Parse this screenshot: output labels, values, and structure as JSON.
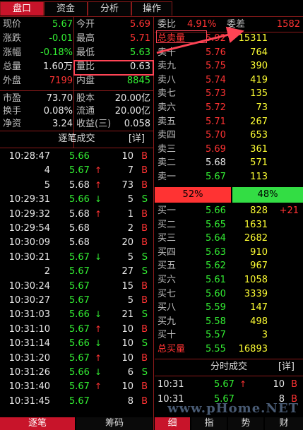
{
  "tabs": [
    "盘口",
    "资金",
    "分析",
    "操作"
  ],
  "quote": {
    "rows": [
      {
        "l1": "现价",
        "v1": "5.67",
        "c1": "g",
        "l2": "今开",
        "v2": "5.69",
        "c2": "r"
      },
      {
        "l1": "涨跌",
        "v1": "-0.01",
        "c1": "g",
        "l2": "最高",
        "v2": "5.71",
        "c2": "r"
      },
      {
        "l1": "涨幅",
        "v1": "-0.18%",
        "c1": "g",
        "l2": "最低",
        "v2": "5.63",
        "c2": "g"
      },
      {
        "l1": "总量",
        "v1": "1.60万",
        "c1": "w",
        "l2": "量比",
        "v2": "0.63",
        "c2": "w"
      },
      {
        "l1": "外盘",
        "v1": "7199",
        "c1": "r",
        "l2": "内盘",
        "v2": "8845",
        "c2": "g"
      },
      {
        "l1": "市盈",
        "v1": "73.70",
        "c1": "w",
        "l2": "股本",
        "v2": "20.00亿",
        "c2": "w"
      },
      {
        "l1": "换手",
        "v1": "0.08%",
        "c1": "w",
        "l2": "流通",
        "v2": "20.00亿",
        "c2": "w"
      },
      {
        "l1": "净资",
        "v1": "3.24",
        "c1": "w",
        "l2": "收益(三)",
        "v2": "0.058",
        "c2": "w"
      }
    ]
  },
  "ticks_header": {
    "title": "逐笔成交",
    "detail": "[详]"
  },
  "ticks": [
    {
      "t": "10:28:47",
      "p": "5.66",
      "pc": "g",
      "a": "",
      "ac": "",
      "v": "10",
      "d": "B",
      "dc": "r"
    },
    {
      "t": "4",
      "p": "5.67",
      "pc": "g",
      "a": "↑",
      "ac": "r",
      "v": "7",
      "d": "B",
      "dc": "r"
    },
    {
      "t": "5",
      "p": "5.68",
      "pc": "w",
      "a": "↑",
      "ac": "r",
      "v": "73",
      "d": "B",
      "dc": "r"
    },
    {
      "t": "10:29:31",
      "p": "5.66",
      "pc": "g",
      "a": "↓",
      "ac": "g",
      "v": "5",
      "d": "S",
      "dc": "g"
    },
    {
      "t": "10:29:32",
      "p": "5.68",
      "pc": "w",
      "a": "↑",
      "ac": "r",
      "v": "1",
      "d": "B",
      "dc": "r"
    },
    {
      "t": "10:29:54",
      "p": "5.68",
      "pc": "w",
      "a": "",
      "ac": "",
      "v": "2",
      "d": "B",
      "dc": "r"
    },
    {
      "t": "10:30:09",
      "p": "5.68",
      "pc": "w",
      "a": "",
      "ac": "",
      "v": "20",
      "d": "B",
      "dc": "r"
    },
    {
      "t": "10:30:21",
      "p": "5.67",
      "pc": "g",
      "a": "↓",
      "ac": "g",
      "v": "5",
      "d": "S",
      "dc": "g"
    },
    {
      "t": "2",
      "p": "5.67",
      "pc": "g",
      "a": "",
      "ac": "",
      "v": "27",
      "d": "S",
      "dc": "g"
    },
    {
      "t": "10:30:24",
      "p": "5.67",
      "pc": "g",
      "a": "",
      "ac": "",
      "v": "15",
      "d": "B",
      "dc": "r"
    },
    {
      "t": "10:30:27",
      "p": "5.67",
      "pc": "g",
      "a": "",
      "ac": "",
      "v": "5",
      "d": "B",
      "dc": "r"
    },
    {
      "t": "10:31:03",
      "p": "5.66",
      "pc": "g",
      "a": "↓",
      "ac": "g",
      "v": "21",
      "d": "S",
      "dc": "g"
    },
    {
      "t": "10:31:10",
      "p": "5.67",
      "pc": "g",
      "a": "↑",
      "ac": "r",
      "v": "10",
      "d": "B",
      "dc": "r"
    },
    {
      "t": "10:31:14",
      "p": "5.66",
      "pc": "g",
      "a": "↓",
      "ac": "g",
      "v": "10",
      "d": "S",
      "dc": "g"
    },
    {
      "t": "10:31:20",
      "p": "5.67",
      "pc": "g",
      "a": "↑",
      "ac": "r",
      "v": "10",
      "d": "B",
      "dc": "r"
    },
    {
      "t": "10:31:26",
      "p": "5.66",
      "pc": "g",
      "a": "↓",
      "ac": "g",
      "v": "6",
      "d": "S",
      "dc": "g"
    },
    {
      "t": "10:31:40",
      "p": "5.67",
      "pc": "g",
      "a": "↑",
      "ac": "r",
      "v": "10",
      "d": "B",
      "dc": "r"
    },
    {
      "t": "10:31:45",
      "p": "5.67",
      "pc": "g",
      "a": "",
      "ac": "",
      "v": "8",
      "d": "B",
      "dc": "r"
    }
  ],
  "left_tabs": [
    "逐笔",
    "筹码"
  ],
  "weibi": {
    "l1": "委比",
    "v1": "4.91%",
    "l2": "委差",
    "v2": "1582"
  },
  "sells": [
    {
      "l": "总卖量",
      "p": "5.92",
      "pc": "r",
      "v": "15311"
    },
    {
      "l": "卖十",
      "p": "5.76",
      "pc": "r",
      "v": "764"
    },
    {
      "l": "卖九",
      "p": "5.75",
      "pc": "r",
      "v": "390"
    },
    {
      "l": "卖八",
      "p": "5.74",
      "pc": "r",
      "v": "419"
    },
    {
      "l": "卖七",
      "p": "5.73",
      "pc": "r",
      "v": "135"
    },
    {
      "l": "卖六",
      "p": "5.72",
      "pc": "r",
      "v": "73"
    },
    {
      "l": "卖五",
      "p": "5.71",
      "pc": "r",
      "v": "267"
    },
    {
      "l": "卖四",
      "p": "5.70",
      "pc": "r",
      "v": "653"
    },
    {
      "l": "卖三",
      "p": "5.69",
      "pc": "r",
      "v": "361"
    },
    {
      "l": "卖二",
      "p": "5.68",
      "pc": "w",
      "v": "571"
    },
    {
      "l": "卖一",
      "p": "5.67",
      "pc": "g",
      "v": "113"
    }
  ],
  "ratio": {
    "sell_pct": "52%",
    "buy_pct": "48%",
    "sell_frac": 0.52,
    "sell_color": "#ff3333",
    "buy_color": "#33dd44"
  },
  "buys": [
    {
      "l": "买一",
      "p": "5.66",
      "pc": "g",
      "v": "828",
      "x": "+21"
    },
    {
      "l": "买二",
      "p": "5.65",
      "pc": "g",
      "v": "1631",
      "x": ""
    },
    {
      "l": "买三",
      "p": "5.64",
      "pc": "g",
      "v": "2682",
      "x": ""
    },
    {
      "l": "买四",
      "p": "5.63",
      "pc": "g",
      "v": "910",
      "x": ""
    },
    {
      "l": "买五",
      "p": "5.62",
      "pc": "g",
      "v": "967",
      "x": ""
    },
    {
      "l": "买六",
      "p": "5.61",
      "pc": "g",
      "v": "1058",
      "x": ""
    },
    {
      "l": "买七",
      "p": "5.60",
      "pc": "g",
      "v": "3339",
      "x": ""
    },
    {
      "l": "买八",
      "p": "5.59",
      "pc": "g",
      "v": "147",
      "x": ""
    },
    {
      "l": "买九",
      "p": "5.58",
      "pc": "g",
      "v": "498",
      "x": ""
    },
    {
      "l": "买十",
      "p": "5.57",
      "pc": "g",
      "v": "3",
      "x": ""
    },
    {
      "l": "总买量",
      "p": "5.55",
      "pc": "g",
      "v": "16893",
      "x": ""
    }
  ],
  "minute_header": {
    "title": "分时成交",
    "detail": "[详]"
  },
  "minute": [
    {
      "t": "10:31",
      "p": "5.67",
      "a": "↑",
      "ac": "r",
      "v": "10",
      "d": "B"
    },
    {
      "t": "10:31",
      "p": "5.67",
      "a": "",
      "ac": "",
      "v": "8",
      "d": "B"
    }
  ],
  "right_tabs": [
    "细",
    "指",
    "势",
    "财"
  ],
  "watermark": "www.pHome.NET"
}
